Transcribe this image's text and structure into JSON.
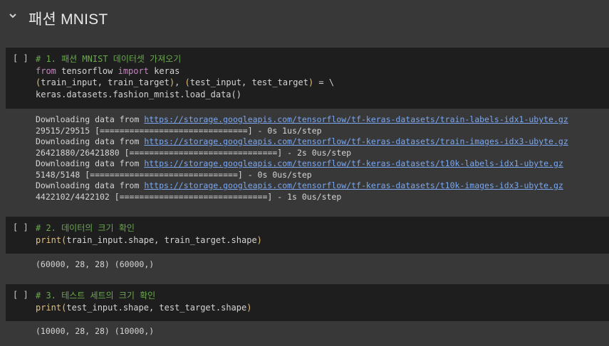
{
  "section": {
    "title": "패션 MNIST",
    "collapse_icon": "chevron-down-icon"
  },
  "cells": [
    {
      "run_label": "[ ]",
      "code": {
        "comment": "# 1. 패션 MNIST 데이터셋 가져오기",
        "line2_kw1": "from",
        "line2_mid": " tensorflow ",
        "line2_kw2": "import",
        "line2_end": " keras",
        "line3_open": "(",
        "line3_a": "train_input, train_target",
        "line3_close": ")",
        "line3_sep": ", ",
        "line3_open2": "(",
        "line3_b": "test_input, test_target",
        "line3_close2": ")",
        "line3_end": " = \\",
        "line4": "keras.datasets.fashion_mnist.load_data()"
      },
      "output": [
        {
          "prefix": "Downloading data from ",
          "link": "https://storage.googleapis.com/tensorflow/tf-keras-datasets/train-labels-idx1-ubyte.gz"
        },
        {
          "text": "29515/29515 [==============================] - 0s 1us/step"
        },
        {
          "prefix": "Downloading data from ",
          "link": "https://storage.googleapis.com/tensorflow/tf-keras-datasets/train-images-idx3-ubyte.gz"
        },
        {
          "text": "26421880/26421880 [==============================] - 2s 0us/step"
        },
        {
          "prefix": "Downloading data from ",
          "link": "https://storage.googleapis.com/tensorflow/tf-keras-datasets/t10k-labels-idx1-ubyte.gz"
        },
        {
          "text": "5148/5148 [==============================] - 0s 0us/step"
        },
        {
          "prefix": "Downloading data from ",
          "link": "https://storage.googleapis.com/tensorflow/tf-keras-datasets/t10k-images-idx3-ubyte.gz"
        },
        {
          "text": "4422102/4422102 [==============================] - 1s 0us/step"
        }
      ]
    },
    {
      "run_label": "[ ]",
      "code": {
        "comment": "# 2. 데이터의 크기 확인",
        "fn": "print",
        "open": "(",
        "args": "train_input.shape, train_target.shape",
        "close": ")"
      },
      "output": [
        {
          "text": "(60000, 28, 28) (60000,)"
        }
      ]
    },
    {
      "run_label": "[ ]",
      "code": {
        "comment": "# 3. 테스트 세트의 크기 확인",
        "fn": "print",
        "open": "(",
        "args": "test_input.shape, test_target.shape",
        "close": ")"
      },
      "output": [
        {
          "text": "(10000, 28, 28) (10000,)"
        }
      ]
    }
  ]
}
